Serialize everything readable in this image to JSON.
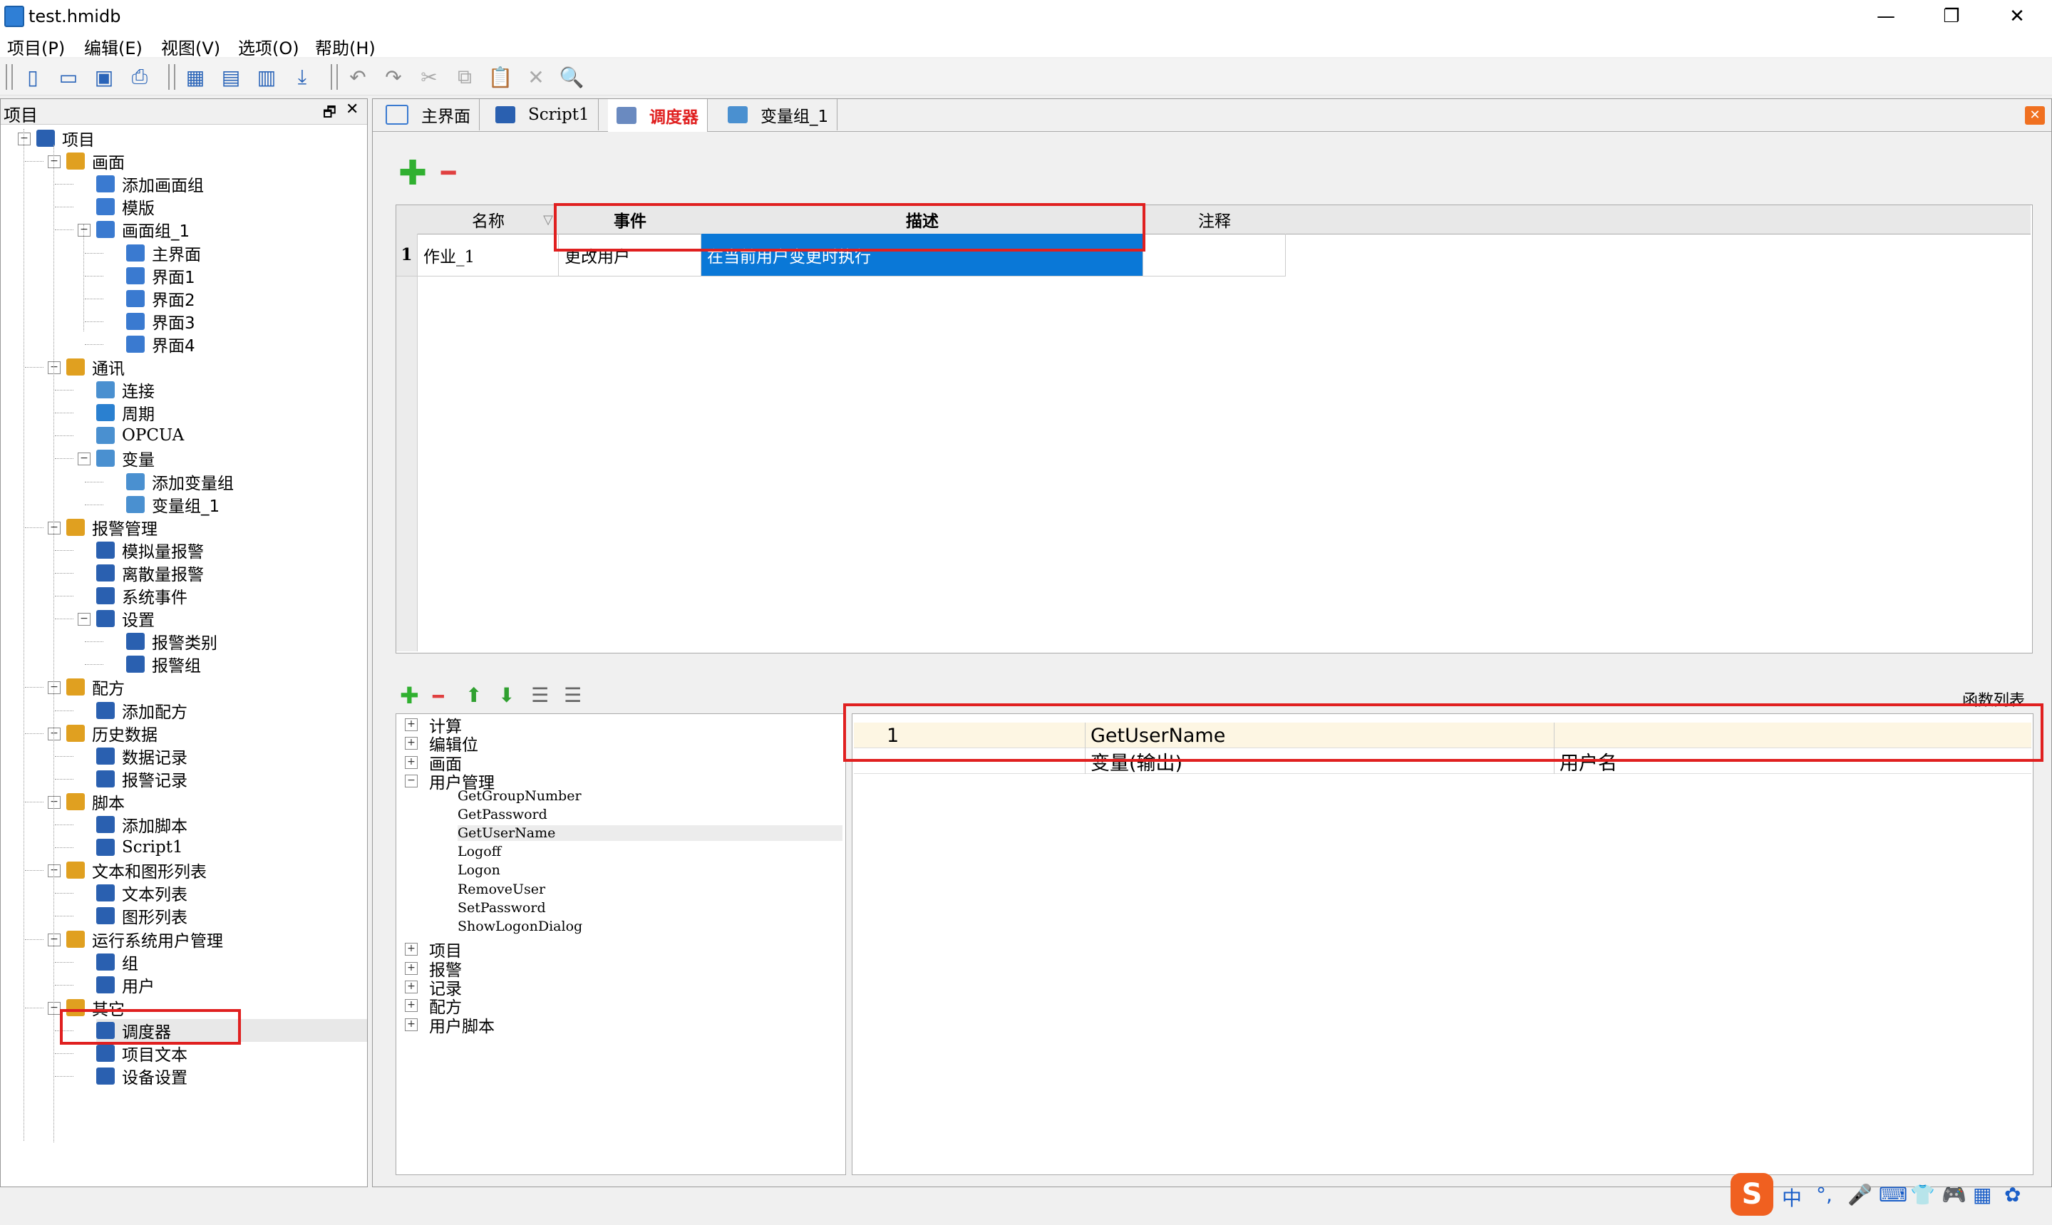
{
  "window": {
    "title": "test.hmidb",
    "minimize": "—",
    "restore": "❐",
    "close": "✕"
  },
  "menu": [
    "项目(P)",
    "编辑(E)",
    "视图(V)",
    "选项(O)",
    "帮助(H)"
  ],
  "left_panel": {
    "title": "项目",
    "pin": "🗗",
    "close": "✕",
    "tree": [
      {
        "label": "项目",
        "level": 0,
        "icon": "project-icon",
        "color": "#2a60b0"
      },
      {
        "label": "画面",
        "level": 1,
        "icon": "screen-folder-icon",
        "color": "#e0a020"
      },
      {
        "label": "添加画面组",
        "level": 2,
        "icon": "add-screen-group-icon",
        "color": "#3a7ad0"
      },
      {
        "label": "模版",
        "level": 2,
        "icon": "template-icon",
        "color": "#3a7ad0"
      },
      {
        "label": "画面组_1",
        "level": 2,
        "icon": "screen-group-icon",
        "color": "#3a7ad0"
      },
      {
        "label": "主界面",
        "level": 3,
        "icon": "screen-icon",
        "color": "#3a7ad0"
      },
      {
        "label": "界面1",
        "level": 3,
        "icon": "screen-icon",
        "color": "#3a7ad0"
      },
      {
        "label": "界面2",
        "level": 3,
        "icon": "screen-icon",
        "color": "#3a7ad0"
      },
      {
        "label": "界面3",
        "level": 3,
        "icon": "screen-icon",
        "color": "#3a7ad0"
      },
      {
        "label": "界面4",
        "level": 3,
        "icon": "screen-icon",
        "color": "#3a7ad0"
      },
      {
        "label": "通讯",
        "level": 1,
        "icon": "communication-icon",
        "color": "#e0a020"
      },
      {
        "label": "连接",
        "level": 2,
        "icon": "connection-icon",
        "color": "#4a90d0"
      },
      {
        "label": "周期",
        "level": 2,
        "icon": "cycle-icon",
        "color": "#2a80d0"
      },
      {
        "label": "OPCUA",
        "level": 2,
        "icon": "opcua-icon",
        "color": "#4a90d0"
      },
      {
        "label": "变量",
        "level": 2,
        "icon": "variable-icon",
        "color": "#4a90d0"
      },
      {
        "label": "添加变量组",
        "level": 3,
        "icon": "add-variable-group-icon",
        "color": "#4a90d0"
      },
      {
        "label": "变量组_1",
        "level": 3,
        "icon": "variable-group-icon",
        "color": "#4a90d0"
      },
      {
        "label": "报警管理",
        "level": 1,
        "icon": "alarm-management-icon",
        "color": "#e0a020"
      },
      {
        "label": "模拟量报警",
        "level": 2,
        "icon": "analog-alarm-icon",
        "color": "#2a60b0"
      },
      {
        "label": "离散量报警",
        "level": 2,
        "icon": "discrete-alarm-icon",
        "color": "#2a60b0"
      },
      {
        "label": "系统事件",
        "level": 2,
        "icon": "system-event-icon",
        "color": "#2a60b0"
      },
      {
        "label": "设置",
        "level": 2,
        "icon": "settings-icon",
        "color": "#2a60b0"
      },
      {
        "label": "报警类别",
        "level": 3,
        "icon": "alarm-class-icon",
        "color": "#2a60b0"
      },
      {
        "label": "报警组",
        "level": 3,
        "icon": "alarm-group-icon",
        "color": "#2a60b0"
      },
      {
        "label": "配方",
        "level": 1,
        "icon": "recipe-icon",
        "color": "#e0a020"
      },
      {
        "label": "添加配方",
        "level": 2,
        "icon": "add-recipe-icon",
        "color": "#2a60b0"
      },
      {
        "label": "历史数据",
        "level": 1,
        "icon": "history-data-icon",
        "color": "#e0a020"
      },
      {
        "label": "数据记录",
        "level": 2,
        "icon": "data-log-icon",
        "color": "#2a60b0"
      },
      {
        "label": "报警记录",
        "level": 2,
        "icon": "alarm-log-icon",
        "color": "#2a60b0"
      },
      {
        "label": "脚本",
        "level": 1,
        "icon": "script-folder-icon",
        "color": "#e0a020"
      },
      {
        "label": "添加脚本",
        "level": 2,
        "icon": "add-script-icon",
        "color": "#2a60b0"
      },
      {
        "label": "Script1",
        "level": 2,
        "icon": "script-icon",
        "color": "#2a60b0"
      },
      {
        "label": "文本和图形列表",
        "level": 1,
        "icon": "text-graphic-list-icon",
        "color": "#e0a020"
      },
      {
        "label": "文本列表",
        "level": 2,
        "icon": "text-list-icon",
        "color": "#2a60b0"
      },
      {
        "label": "图形列表",
        "level": 2,
        "icon": "graphic-list-icon",
        "color": "#2a60b0"
      },
      {
        "label": "运行系统用户管理",
        "level": 1,
        "icon": "runtime-user-management-icon",
        "color": "#e0a020"
      },
      {
        "label": "组",
        "level": 2,
        "icon": "group-icon",
        "color": "#2a60b0"
      },
      {
        "label": "用户",
        "level": 2,
        "icon": "user-icon",
        "color": "#2a60b0"
      },
      {
        "label": "其它",
        "level": 1,
        "icon": "others-folder-icon",
        "color": "#e0a020"
      },
      {
        "label": "调度器",
        "level": 2,
        "icon": "scheduler-icon",
        "color": "#2a60b0"
      },
      {
        "label": "项目文本",
        "level": 2,
        "icon": "project-text-icon",
        "color": "#2a60b0"
      },
      {
        "label": "设备设置",
        "level": 2,
        "icon": "device-settings-icon",
        "color": "#2a60b0"
      }
    ]
  },
  "tabs": [
    {
      "label": "主界面",
      "icon": "screen-icon",
      "active": false
    },
    {
      "label": "Script1",
      "icon": "script-icon",
      "active": false
    },
    {
      "label": "调度器",
      "icon": "scheduler-icon",
      "active": true
    },
    {
      "label": "变量组_1",
      "icon": "variable-group-icon",
      "active": false
    }
  ],
  "tab_close": "✕",
  "scheduler": {
    "add": "✚",
    "remove": "━",
    "columns": [
      "名称",
      "事件",
      "描述",
      "注释"
    ],
    "rows": [
      {
        "index": "1",
        "name": "作业_1",
        "event": "更改用户",
        "description": "在当前用户变更时执行",
        "comment": ""
      }
    ]
  },
  "function_panel": {
    "title": "函数列表",
    "toolbar": [
      "✚",
      "━",
      "⬆",
      "⬇",
      "☰",
      "☰"
    ],
    "categories": [
      {
        "label": "计算",
        "expanded": false
      },
      {
        "label": "编辑位",
        "expanded": false
      },
      {
        "label": "画面",
        "expanded": false
      },
      {
        "label": "用户管理",
        "expanded": true,
        "children": [
          "GetGroupNumber",
          "GetPassword",
          "GetUserName",
          "Logoff",
          "Logon",
          "RemoveUser",
          "SetPassword",
          "ShowLogonDialog"
        ]
      },
      {
        "label": "项目",
        "expanded": false
      },
      {
        "label": "报警",
        "expanded": false
      },
      {
        "label": "记录",
        "expanded": false
      },
      {
        "label": "配方",
        "expanded": false
      },
      {
        "label": "用户脚本",
        "expanded": false
      }
    ],
    "selected_child": "GetUserName",
    "function_row": {
      "index": "1",
      "name": "GetUserName"
    },
    "param_row": {
      "param": "变量(输出)",
      "value": "用户名"
    }
  },
  "colors": {
    "accent_red": "#e02020",
    "selection_blue": "#0a78d7",
    "tab_active": "#e02020"
  },
  "ime": [
    "S",
    "中",
    "°,",
    "🎤",
    "⌨",
    "👕",
    "🎮",
    "▦",
    "✿"
  ]
}
